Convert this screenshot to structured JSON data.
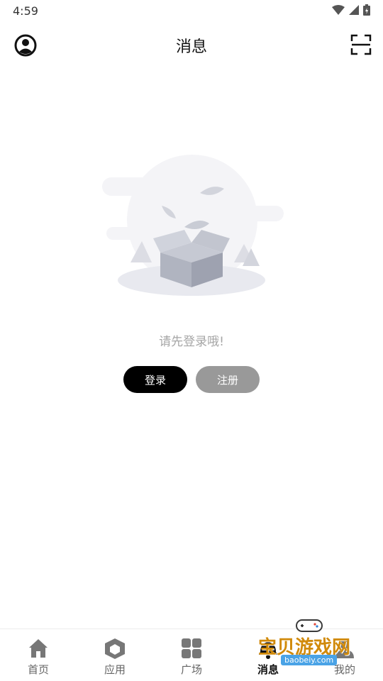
{
  "status_bar": {
    "time": "4:59"
  },
  "header": {
    "title": "消息"
  },
  "empty_state": {
    "message": "请先登录哦!"
  },
  "actions": {
    "login_label": "登录",
    "register_label": "注册"
  },
  "bottom_nav": {
    "items": [
      {
        "label": "首页",
        "icon": "home-icon"
      },
      {
        "label": "应用",
        "icon": "cube-icon"
      },
      {
        "label": "广场",
        "icon": "grid-icon"
      },
      {
        "label": "消息",
        "icon": "message-icon"
      },
      {
        "label": "我的",
        "icon": "profile-icon"
      }
    ],
    "active_index": 3
  },
  "watermark": {
    "text": "宝贝游戏网",
    "url": "baobeiy.com"
  },
  "colors": {
    "primary": "#000000",
    "secondary_button": "#999999",
    "muted_text": "#a6a6a6"
  }
}
